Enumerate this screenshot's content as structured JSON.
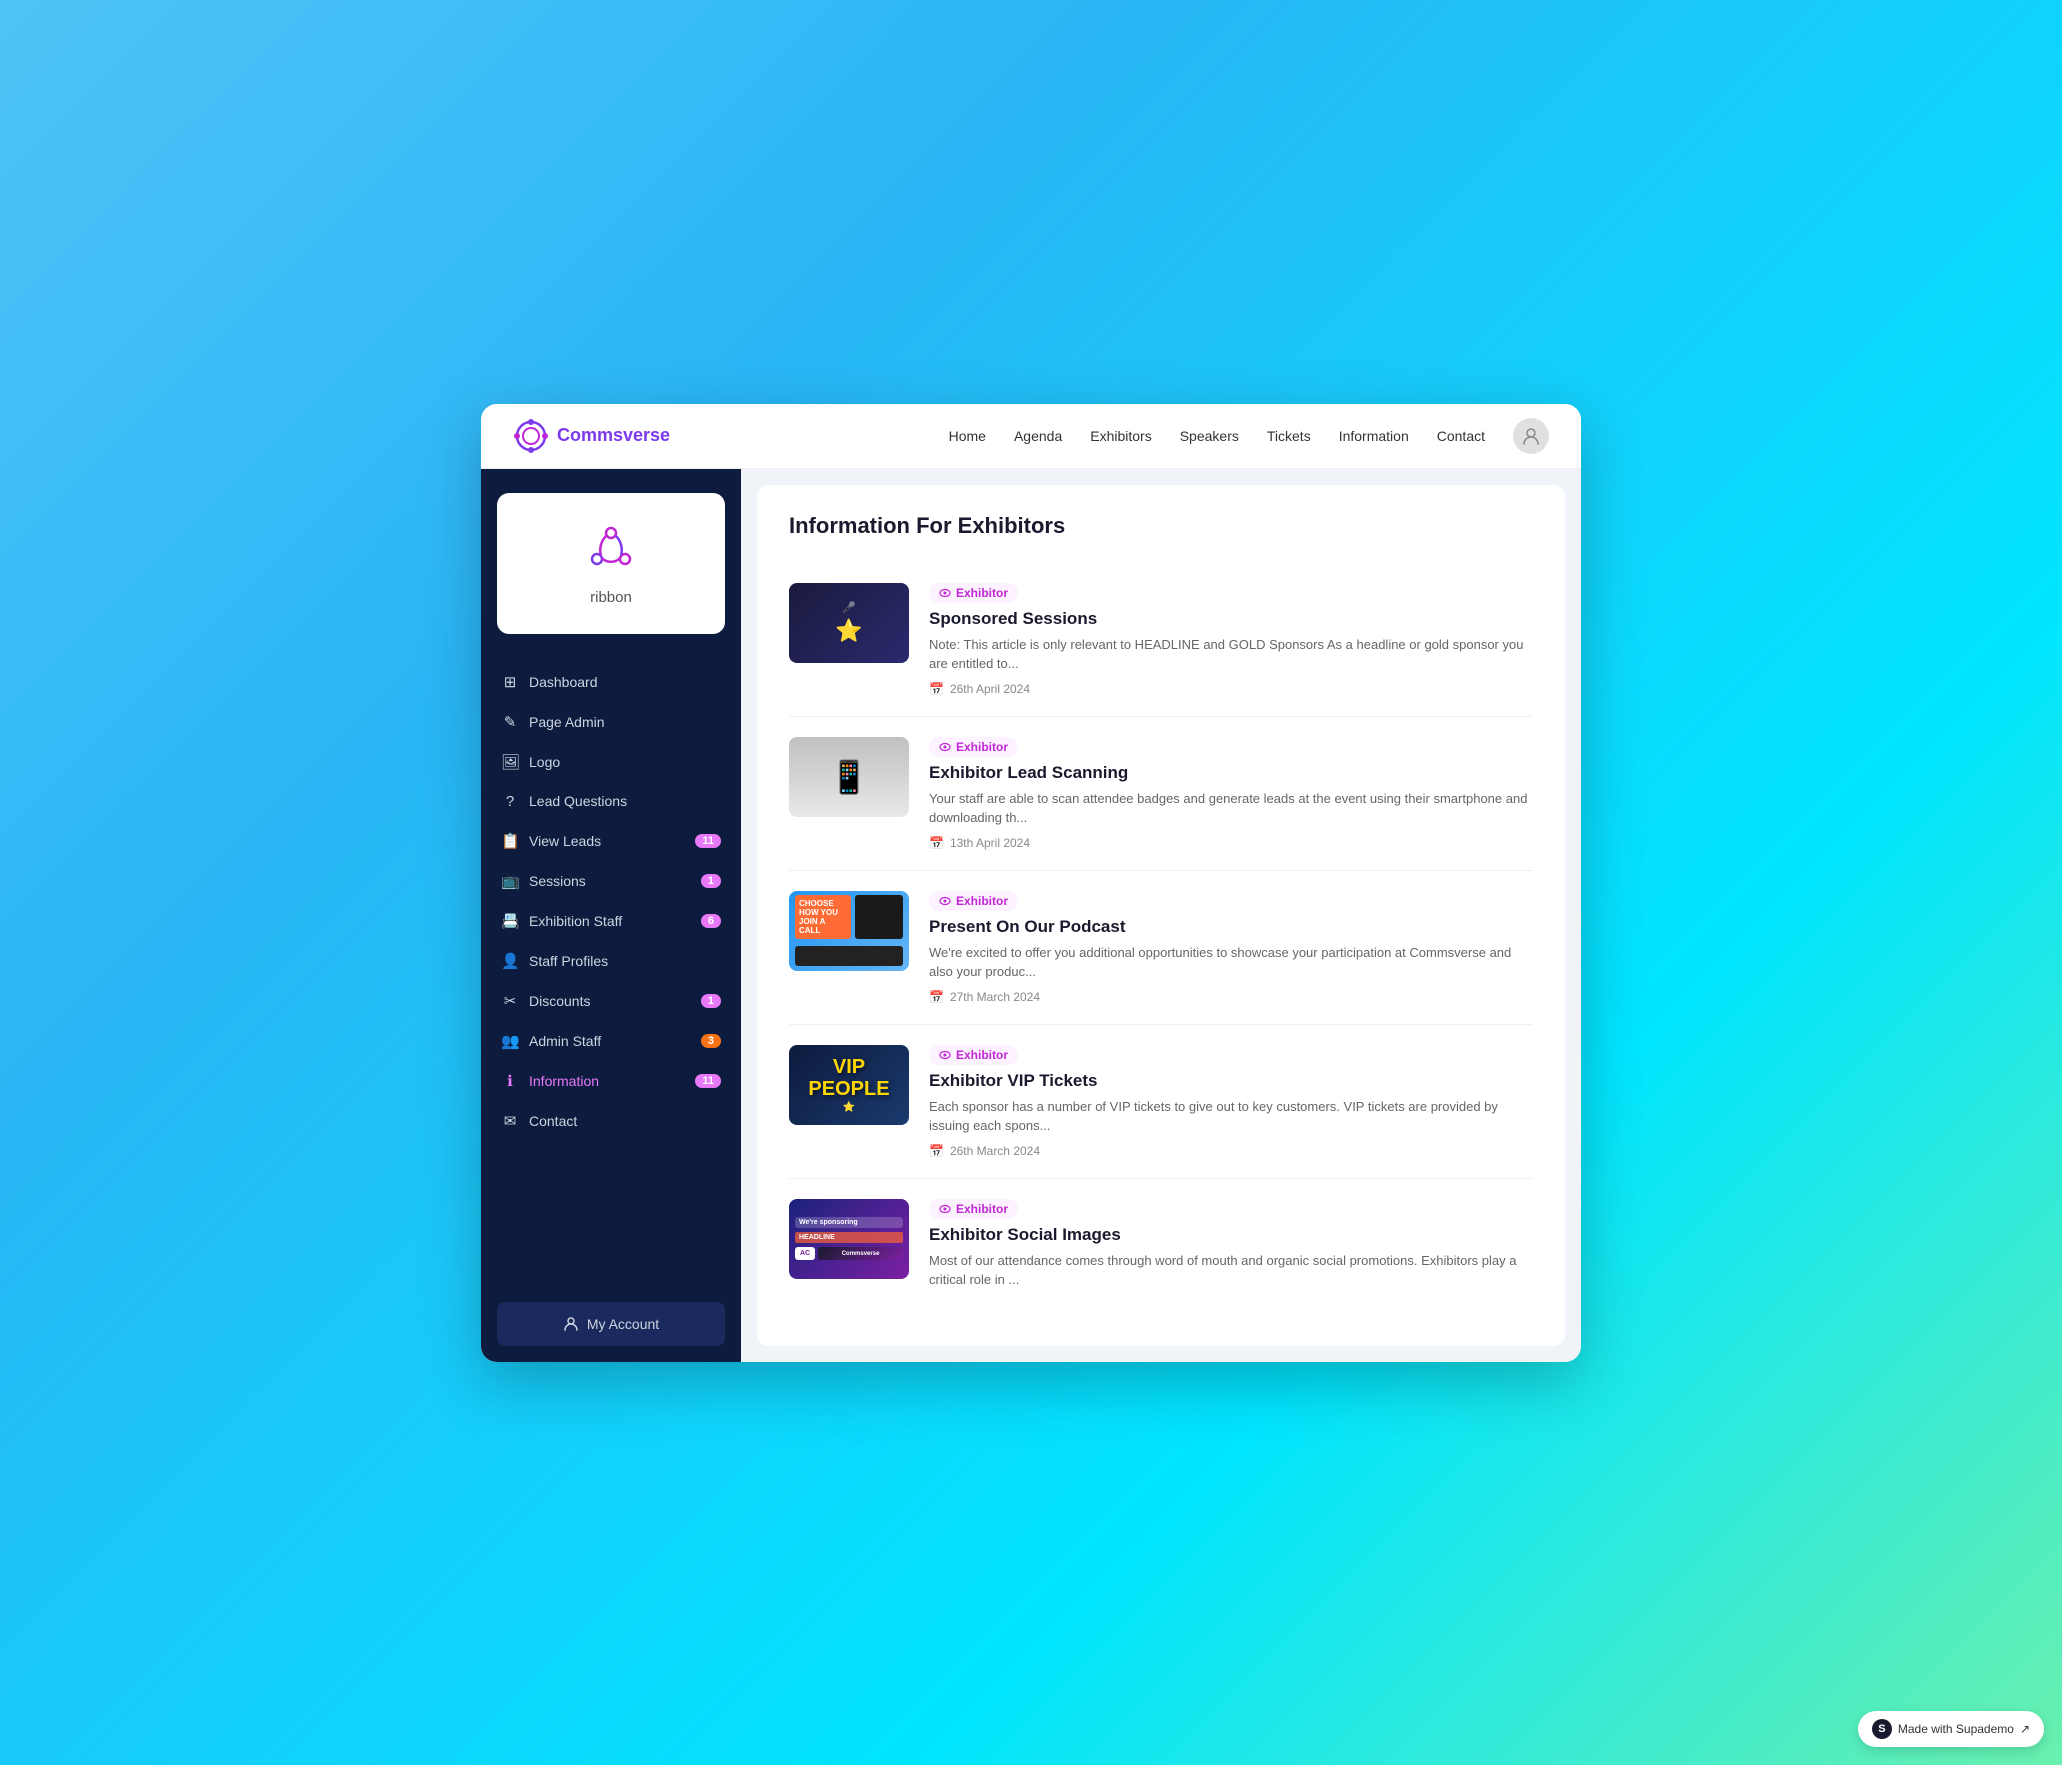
{
  "app": {
    "name_prefix": "Comms",
    "name_suffix": "verse"
  },
  "top_nav": {
    "links": [
      "Home",
      "Agenda",
      "Exhibitors",
      "Speakers",
      "Tickets",
      "Information",
      "Contact"
    ]
  },
  "sidebar": {
    "company_logo_text": "ribbon",
    "nav_items": [
      {
        "id": "dashboard",
        "label": "Dashboard",
        "icon": "⊞",
        "badge": null
      },
      {
        "id": "page-admin",
        "label": "Page Admin",
        "icon": "✎",
        "badge": null
      },
      {
        "id": "logo",
        "label": "Logo",
        "icon": "🖼",
        "badge": null
      },
      {
        "id": "lead-questions",
        "label": "Lead Questions",
        "icon": "?",
        "badge": null
      },
      {
        "id": "view-leads",
        "label": "View Leads",
        "icon": "📋",
        "badge": "11"
      },
      {
        "id": "sessions",
        "label": "Sessions",
        "icon": "📺",
        "badge": "1"
      },
      {
        "id": "exhibition-staff",
        "label": "Exhibition Staff",
        "icon": "📇",
        "badge": "6"
      },
      {
        "id": "staff-profiles",
        "label": "Staff Profiles",
        "icon": "👤",
        "badge": null
      },
      {
        "id": "discounts",
        "label": "Discounts",
        "icon": "✂",
        "badge": "1"
      },
      {
        "id": "admin-staff",
        "label": "Admin Staff",
        "icon": "👥",
        "badge": "3"
      },
      {
        "id": "information",
        "label": "Information",
        "icon": "ℹ",
        "badge": "11",
        "active": true
      },
      {
        "id": "contact",
        "label": "Contact",
        "icon": "✉",
        "badge": null
      }
    ],
    "my_account_label": "My Account"
  },
  "content": {
    "page_title": "Information For Exhibitors",
    "articles": [
      {
        "id": "sponsored-sessions",
        "tag": "Exhibitor",
        "title": "Sponsored Sessions",
        "excerpt": "Note: This article is only relevant to HEADLINE and GOLD Sponsors As a headline or gold sponsor you are entitled to...",
        "date": "26th April 2024",
        "thumb_type": "sponsored"
      },
      {
        "id": "exhibitor-lead-scanning",
        "tag": "Exhibitor",
        "title": "Exhibitor Lead Scanning",
        "excerpt": "Your staff are able to scan attendee badges and generate leads at the event using their smartphone and downloading th...",
        "date": "13th April 2024",
        "thumb_type": "scanning"
      },
      {
        "id": "present-on-podcast",
        "tag": "Exhibitor",
        "title": "Present On Our Podcast",
        "excerpt": "We're excited to offer you additional opportunities to showcase your participation at Commsverse and also your produc...",
        "date": "27th March 2024",
        "thumb_type": "podcast"
      },
      {
        "id": "exhibitor-vip-tickets",
        "tag": "Exhibitor",
        "title": "Exhibitor VIP Tickets",
        "excerpt": "Each sponsor has a number of VIP tickets to give out to key customers. VIP tickets are provided by issuing each spons...",
        "date": "26th March 2024",
        "thumb_type": "vip"
      },
      {
        "id": "exhibitor-social-images",
        "tag": "Exhibitor",
        "title": "Exhibitor Social Images",
        "excerpt": "Most of our attendance comes through word of mouth and organic social promotions. Exhibitors play a critical role in ...",
        "date": "",
        "thumb_type": "social"
      }
    ]
  },
  "supademo": {
    "label": "Made with Supademo",
    "icon": "S",
    "arrow": "↗"
  }
}
